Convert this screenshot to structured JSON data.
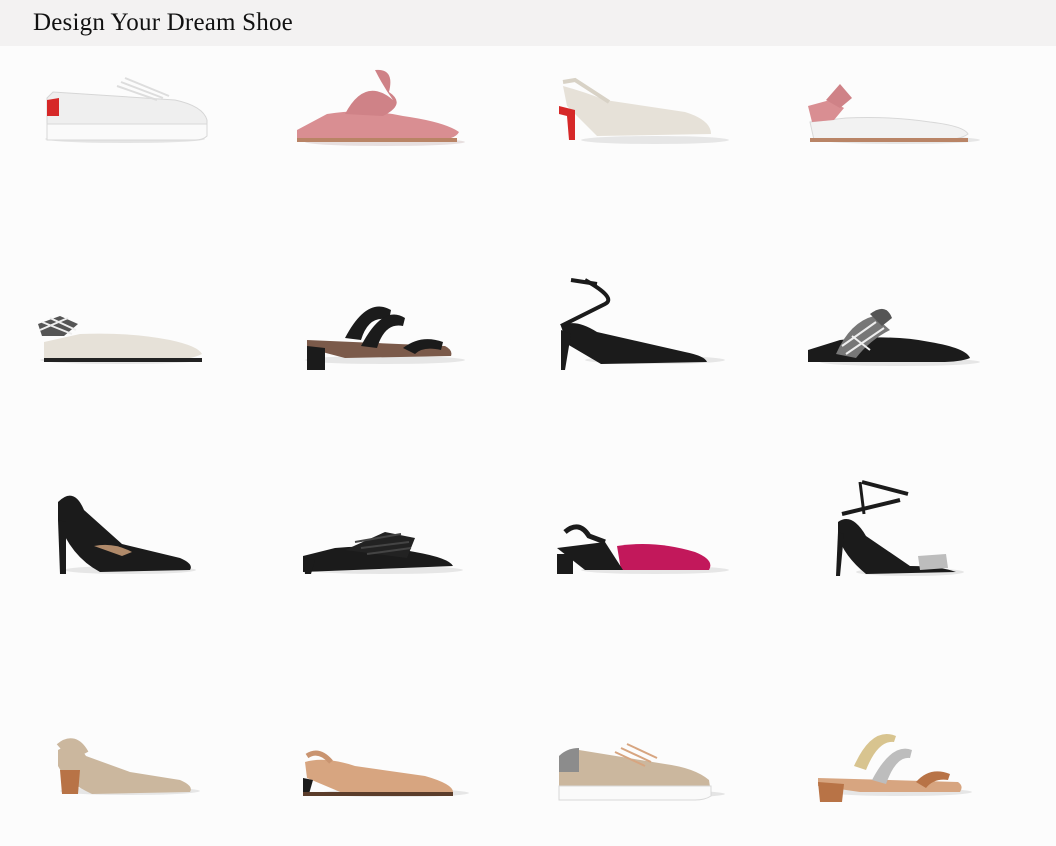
{
  "header": {
    "title": "Design Your Dream Shoe"
  },
  "colors": {
    "header_bg": "#f3f2f2",
    "page_bg": "#fcfcfc",
    "black": "#1b1b1b",
    "pink": "#d98e92",
    "ivory": "#e6e1d8",
    "white": "#f2f2f2",
    "red": "#d62828",
    "magenta": "#c2185b",
    "tan": "#cbb79e",
    "nude": "#d7a580",
    "copper": "#b87346",
    "silver": "#bdbdbd",
    "gold": "#d8c48f"
  },
  "shoes": [
    {
      "name": "white-lace-up-sneaker-red-heel-tab",
      "style": "sneaker"
    },
    {
      "name": "pink-bow-pointed-mule",
      "style": "bow-flat"
    },
    {
      "name": "ivory-slingback-kitten-heel-red-heel",
      "style": "slingback-heel"
    },
    {
      "name": "white-slingback-flat-pink-bow",
      "style": "bow-slingback"
    },
    {
      "name": "ivory-slingback-flat-plaid-bow",
      "style": "bow-slingback"
    },
    {
      "name": "black-triple-strap-block-heel-sandal",
      "style": "strap-sandal"
    },
    {
      "name": "black-ankle-strap-pointed-heel",
      "style": "ankle-pump"
    },
    {
      "name": "black-plaid-bow-pointed-mule",
      "style": "bow-flat"
    },
    {
      "name": "black-stiletto-pump",
      "style": "stiletto"
    },
    {
      "name": "black-ruffle-kitten-heel-mule",
      "style": "ruffle-mule"
    },
    {
      "name": "magenta-black-slingback-block-heel",
      "style": "slingback-block"
    },
    {
      "name": "black-silver-strappy-heel-sandal",
      "style": "strappy-heel"
    },
    {
      "name": "tan-block-heel-pump-copper-heel",
      "style": "block-pump"
    },
    {
      "name": "nude-slingback-kitten-heel",
      "style": "slingback-heel"
    },
    {
      "name": "tan-lace-up-sneaker-snake-heel",
      "style": "sneaker"
    },
    {
      "name": "copper-silver-gold-strap-block-sandal",
      "style": "strap-sandal"
    }
  ]
}
